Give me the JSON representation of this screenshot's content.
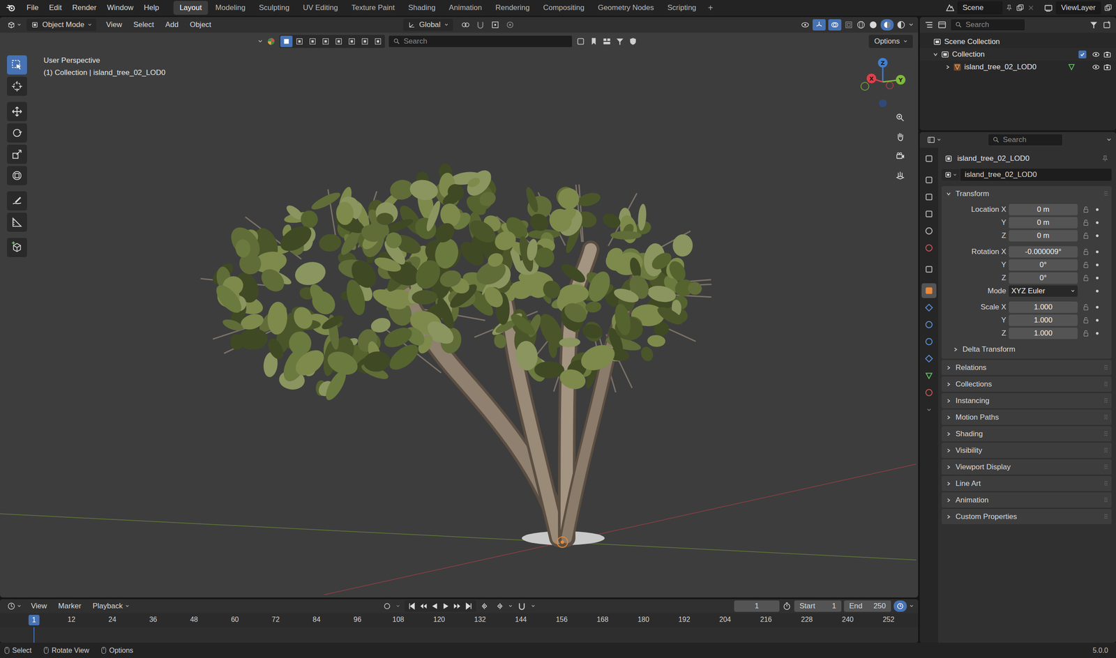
{
  "top_bar": {
    "menus": [
      "File",
      "Edit",
      "Render",
      "Window",
      "Help"
    ],
    "workspaces": [
      {
        "label": "Layout",
        "selected": true
      },
      {
        "label": "Modeling",
        "selected": false
      },
      {
        "label": "Sculpting",
        "selected": false
      },
      {
        "label": "UV Editing",
        "selected": false
      },
      {
        "label": "Texture Paint",
        "selected": false
      },
      {
        "label": "Shading",
        "selected": false
      },
      {
        "label": "Animation",
        "selected": false
      },
      {
        "label": "Rendering",
        "selected": false
      },
      {
        "label": "Compositing",
        "selected": false
      },
      {
        "label": "Geometry Nodes",
        "selected": false
      },
      {
        "label": "Scripting",
        "selected": false
      }
    ],
    "add_workspace": "+",
    "scene": "Scene",
    "view_layer": "ViewLayer"
  },
  "viewport": {
    "mode": "Object Mode",
    "menus": [
      "View",
      "Select",
      "Add",
      "Object"
    ],
    "orientation": "Global",
    "search_placeholder": "Search",
    "options": "Options",
    "view_name": "User Perspective",
    "context": "(1) Collection | island_tree_02_LOD0",
    "gizmo_axes": [
      "X",
      "Y",
      "Z"
    ],
    "tools": [
      {
        "kind": "select",
        "selected": true
      },
      {
        "kind": "cursor",
        "selected": false
      },
      {
        "kind": "move",
        "selected": false
      },
      {
        "kind": "rotate",
        "selected": false
      },
      {
        "kind": "scale",
        "selected": false
      },
      {
        "kind": "transform",
        "selected": false
      },
      {
        "kind": "annotate",
        "selected": false
      },
      {
        "kind": "measure",
        "selected": false
      },
      {
        "kind": "add-cube",
        "selected": false
      }
    ]
  },
  "timeline": {
    "menus": [
      "View",
      "Marker",
      "Playback"
    ],
    "current_frame": "1",
    "start_label": "Start",
    "start": "1",
    "end_label": "End",
    "end": "250",
    "ruler": [
      {
        "label": "1",
        "selected": true
      },
      {
        "label": "12",
        "selected": false
      },
      {
        "label": "24",
        "selected": false
      },
      {
        "label": "36",
        "selected": false
      },
      {
        "label": "48",
        "selected": false
      },
      {
        "label": "60",
        "selected": false
      },
      {
        "label": "72",
        "selected": false
      },
      {
        "label": "84",
        "selected": false
      },
      {
        "label": "96",
        "selected": false
      },
      {
        "label": "108",
        "selected": false
      },
      {
        "label": "120",
        "selected": false
      },
      {
        "label": "132",
        "selected": false
      },
      {
        "label": "144",
        "selected": false
      },
      {
        "label": "156",
        "selected": false
      },
      {
        "label": "168",
        "selected": false
      },
      {
        "label": "180",
        "selected": false
      },
      {
        "label": "192",
        "selected": false
      },
      {
        "label": "204",
        "selected": false
      },
      {
        "label": "216",
        "selected": false
      },
      {
        "label": "228",
        "selected": false
      },
      {
        "label": "240",
        "selected": false
      },
      {
        "label": "252",
        "selected": false
      }
    ]
  },
  "outliner": {
    "search_placeholder": "Search",
    "root": "Scene Collection",
    "rows": [
      {
        "kind": "collection",
        "label": "Collection",
        "expanded": true,
        "checked": true,
        "visible": true,
        "renderable": true
      },
      {
        "kind": "object",
        "label": "island_tree_02_LOD0",
        "expanded": false,
        "checked": true,
        "visible": true,
        "renderable": true
      }
    ]
  },
  "properties": {
    "search_placeholder": "Search",
    "tabs": [
      {
        "kind": "tool",
        "selected": false
      },
      {
        "kind": "render",
        "selected": false
      },
      {
        "kind": "output",
        "selected": false
      },
      {
        "kind": "view-layer",
        "selected": false
      },
      {
        "kind": "scene",
        "selected": false
      },
      {
        "kind": "world",
        "selected": false
      },
      {
        "kind": "collection",
        "selected": false
      },
      {
        "kind": "object",
        "selected": true
      },
      {
        "kind": "modifiers",
        "selected": false
      },
      {
        "kind": "particles",
        "selected": false
      },
      {
        "kind": "physics",
        "selected": false
      },
      {
        "kind": "constraints",
        "selected": false
      },
      {
        "kind": "data",
        "selected": false
      },
      {
        "kind": "material",
        "selected": false
      }
    ],
    "object_name": "island_tree_02_LOD0",
    "datablock": "island_tree_02_LOD0",
    "transform": {
      "title": "Transform",
      "expanded": true,
      "groups": [
        {
          "rows": [
            {
              "kind": "number",
              "label": "Location X",
              "value": "0 m"
            },
            {
              "kind": "number",
              "label": "Y",
              "value": "0 m"
            },
            {
              "kind": "number",
              "label": "Z",
              "value": "0 m"
            }
          ]
        },
        {
          "rows": [
            {
              "kind": "number",
              "label": "Rotation X",
              "value": "-0.000009°"
            },
            {
              "kind": "number",
              "label": "Y",
              "value": "0°"
            },
            {
              "kind": "number",
              "label": "Z",
              "value": "0°"
            },
            {
              "kind": "dropdown",
              "label": "Mode",
              "value": "XYZ Euler"
            }
          ]
        },
        {
          "rows": [
            {
              "kind": "number",
              "label": "Scale X",
              "value": "1.000"
            },
            {
              "kind": "number",
              "label": "Y",
              "value": "1.000"
            },
            {
              "kind": "number",
              "label": "Z",
              "value": "1.000"
            }
          ]
        }
      ],
      "delta": {
        "title": "Delta Transform",
        "expanded": false
      }
    },
    "panels": [
      {
        "title": "Relations",
        "expanded": false
      },
      {
        "title": "Collections",
        "expanded": false
      },
      {
        "title": "Instancing",
        "expanded": false
      },
      {
        "title": "Motion Paths",
        "expanded": false
      },
      {
        "title": "Shading",
        "expanded": false
      },
      {
        "title": "Visibility",
        "expanded": false
      },
      {
        "title": "Viewport Display",
        "expanded": false
      },
      {
        "title": "Line Art",
        "expanded": false
      },
      {
        "title": "Animation",
        "expanded": false
      },
      {
        "title": "Custom Properties",
        "expanded": false
      }
    ]
  },
  "status_bar": {
    "items": [
      "Select",
      "Rotate View",
      "Options"
    ],
    "version": "5.0.0"
  }
}
